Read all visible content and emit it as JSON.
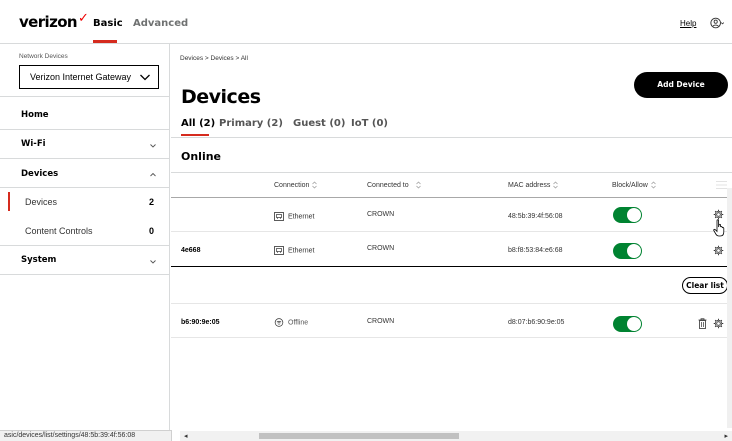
{
  "header": {
    "brand": "verizon",
    "brand_mark": "✓",
    "tabs": [
      "Basic",
      "Advanced"
    ],
    "active_tab": "Basic",
    "help": "Help",
    "user_icon": "user-circle-icon"
  },
  "sidebar": {
    "network_devices_label": "Network Devices",
    "selected_device": "Verizon Internet Gateway",
    "items": [
      {
        "label": "Home"
      },
      {
        "label": "Wi-Fi",
        "expanded": false
      },
      {
        "label": "Devices",
        "expanded": true,
        "children": [
          {
            "label": "Devices",
            "count": "2",
            "active": true
          },
          {
            "label": "Content Controls",
            "count": "0"
          }
        ]
      },
      {
        "label": "System",
        "expanded": false
      }
    ]
  },
  "main": {
    "breadcrumb": "Devices  >  Devices  >  All",
    "title": "Devices",
    "add_button": "Add Device",
    "tabs": [
      {
        "label": "All (2)",
        "active": true
      },
      {
        "label": "Primary (2)"
      },
      {
        "label": "Guest (0)"
      },
      {
        "label": "IoT (0)"
      }
    ],
    "section_heading": "Online",
    "columns": [
      "Connection",
      "Connected to",
      "MAC address",
      "Block/Allow"
    ],
    "online_rows": [
      {
        "name": "",
        "connection": "Ethernet",
        "connected_to": "CROWN",
        "mac": "48:5b:39:4f:56:08",
        "allowed": true
      },
      {
        "name": "4e668",
        "connection": "Ethernet",
        "connected_to": "CROWN",
        "mac": "b8:f8:53:84:e6:68",
        "allowed": true
      }
    ],
    "clear_list_button": "Clear list",
    "offline_rows": [
      {
        "name": "b6:90:9e:05",
        "connection": "Offline",
        "connected_to": "CROWN",
        "mac": "d8:07:b6:90:9e:05",
        "allowed": true
      }
    ]
  },
  "status_bar": {
    "url": "asic/devices/list/settings/48:5b:39:4f:56:08"
  },
  "colors": {
    "accent_red": "#d52b1e",
    "toggle_green": "#008331",
    "button_black": "#000000"
  }
}
